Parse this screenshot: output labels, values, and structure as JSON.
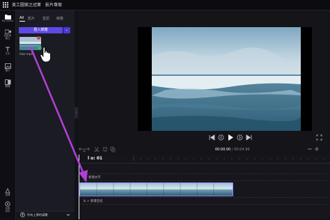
{
  "window": {
    "project_title": "美工圖案之冠軍　影片專案"
  },
  "rail": {
    "items": [
      {
        "label": "My media",
        "icon": "folder-icon"
      },
      {
        "label": "錄影與\n建立",
        "icon": "camera-icon"
      },
      {
        "label": "文字",
        "icon": "text-icon"
      },
      {
        "label": "圖片",
        "icon": "image-icon"
      },
      {
        "label": "轉場",
        "icon": "transitions-icon"
      },
      {
        "label": "品牌",
        "icon": "brand-kit-icon"
      },
      {
        "label": "功能\n設定",
        "icon": "more-icon"
      }
    ]
  },
  "media_panel": {
    "tabs": [
      "All",
      "影片",
      "音訊",
      "映像"
    ],
    "active_tab": "All",
    "import_label": "匯入媒體",
    "import_dropdown": "⌄",
    "media_item": {
      "filename": "fake.mp4"
    },
    "footer_label": "所有上傳的媒體"
  },
  "playback": {
    "current": "00:00.00",
    "total": " / 00:04.99"
  },
  "timeline": {
    "ruler_time": "l o: 01",
    "add_text": "+  新增文字",
    "add_audio": "& +  新增音訊"
  },
  "colors": {
    "accent": "#5d4ae6",
    "annotation_arrow": "#b13fd6",
    "track_border": "#8f86ff"
  }
}
